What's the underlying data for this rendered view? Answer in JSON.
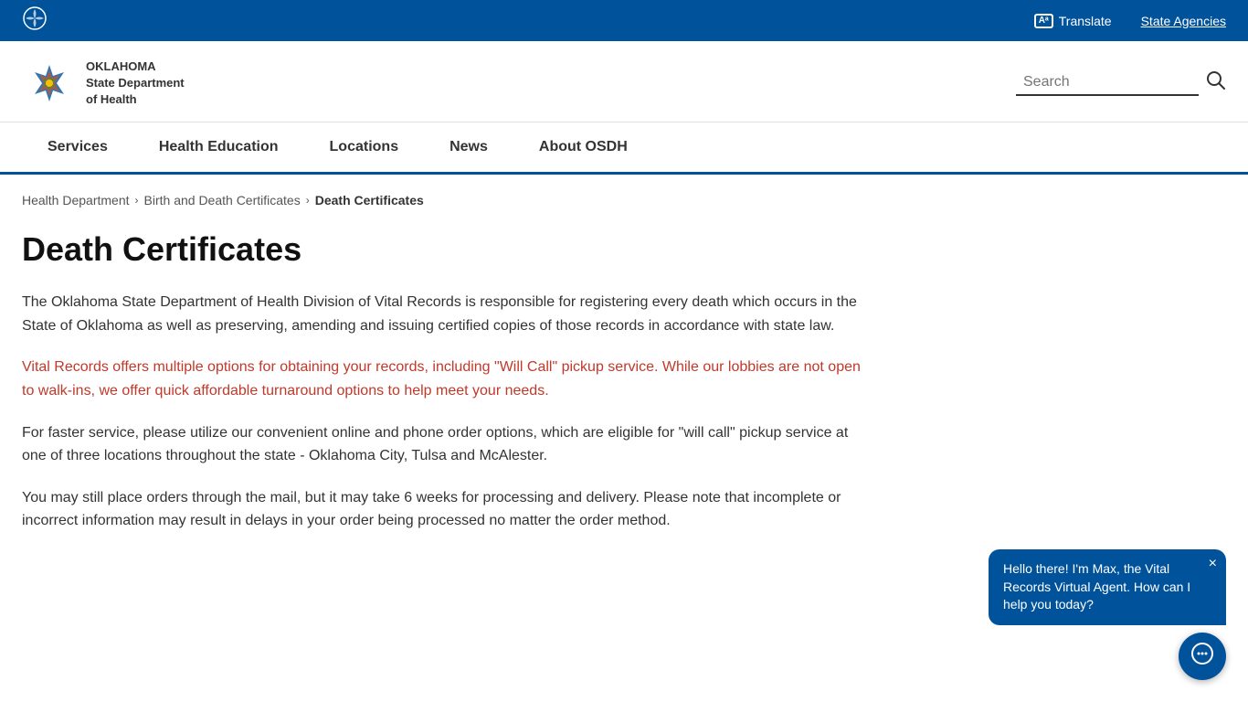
{
  "topbar": {
    "translate_label": "Translate",
    "state_agencies_label": "State Agencies"
  },
  "header": {
    "logo_line1": "OKLAHOMA",
    "logo_line2": "State Department",
    "logo_line3": "of Health",
    "search_placeholder": "Search",
    "search_label": "Search"
  },
  "nav": {
    "items": [
      {
        "label": "Services",
        "id": "services"
      },
      {
        "label": "Health Education",
        "id": "health-education"
      },
      {
        "label": "Locations",
        "id": "locations"
      },
      {
        "label": "News",
        "id": "news"
      },
      {
        "label": "About OSDH",
        "id": "about-osdh"
      }
    ]
  },
  "breadcrumb": {
    "items": [
      {
        "label": "Health Department",
        "id": "health-department"
      },
      {
        "label": "Birth and Death Certificates",
        "id": "birth-death"
      },
      {
        "label": "Death Certificates",
        "id": "death-certs",
        "current": true
      }
    ]
  },
  "main": {
    "page_title": "Death Certificates",
    "para1": "The Oklahoma State Department of Health Division of Vital Records is responsible for registering every death which occurs in the State of Oklahoma as well as preserving, amending and issuing certified copies of those records in accordance with state law.",
    "para2_link": "Vital Records offers multiple options for obtaining your records, including \"Will Call\" pickup service. While our lobbies are not open to walk-ins, we offer quick affordable turnaround options to help meet your needs.",
    "para3": "For faster service, please utilize our convenient online and phone order options, which are eligible for \"will call\" pickup service at one of three locations throughout the state - Oklahoma City, Tulsa and McAlester.",
    "para4": "You may still place orders through the mail, but it may take 6 weeks for processing and delivery. Please note that incomplete or incorrect information may result in delays in your order being processed no matter the order method."
  },
  "chat": {
    "bubble_text": "Hello there! I'm Max, the Vital Records Virtual Agent. How can I help you today?",
    "close_label": "×",
    "button_icon": "💬"
  }
}
